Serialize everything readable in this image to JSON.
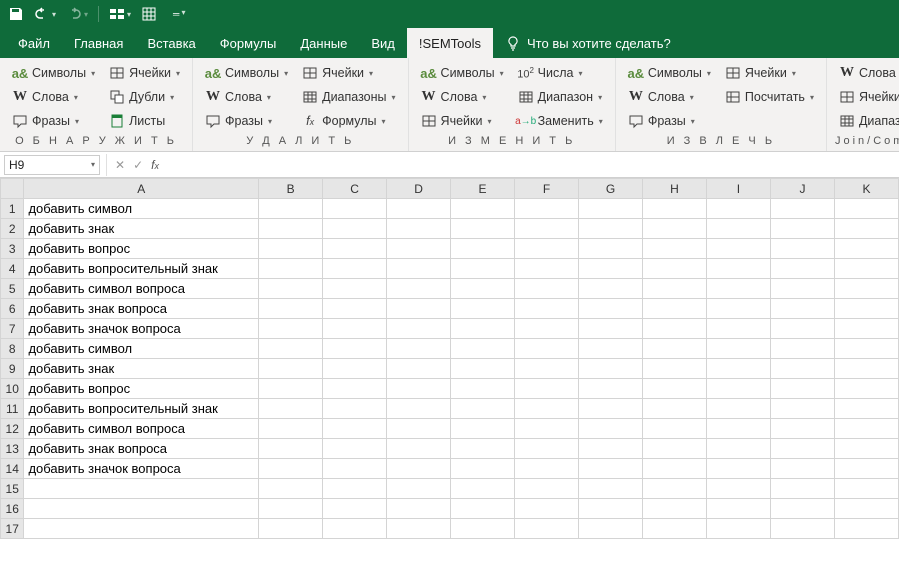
{
  "tabs": [
    "Файл",
    "Главная",
    "Вставка",
    "Формулы",
    "Данные",
    "Вид",
    "!SEMTools"
  ],
  "active_tab": 6,
  "search_hint": "Что вы хотите сделать?",
  "ribbon": {
    "groups": [
      {
        "label": "О Б Н А Р У Ж И Т Ь",
        "btns": [
          {
            "ic": "sym",
            "t": "Символы"
          },
          {
            "ic": "W",
            "t": "Слова"
          },
          {
            "ic": "phr",
            "t": "Фразы"
          },
          {
            "ic": "cell",
            "t": "Ячейки"
          },
          {
            "ic": "dup",
            "t": "Дубли"
          },
          {
            "ic": "sheet",
            "t": "Листы",
            "dd": false
          }
        ]
      },
      {
        "label": "У Д А Л И Т Ь",
        "btns": [
          {
            "ic": "sym",
            "t": "Символы"
          },
          {
            "ic": "W",
            "t": "Слова"
          },
          {
            "ic": "phr",
            "t": "Фразы"
          },
          {
            "ic": "cell",
            "t": "Ячейки"
          },
          {
            "ic": "rng",
            "t": "Диапазоны"
          },
          {
            "ic": "fx",
            "t": "Формулы"
          }
        ]
      },
      {
        "label": "И З М Е Н И Т Ь",
        "btns": [
          {
            "ic": "sym",
            "t": "Символы"
          },
          {
            "ic": "W",
            "t": "Слова"
          },
          {
            "ic": "cell",
            "t": "Ячейки"
          },
          {
            "ic": "num",
            "t": "Числа"
          },
          {
            "ic": "rng",
            "t": "Диапазон"
          },
          {
            "ic": "rep",
            "t": "Заменить"
          }
        ]
      },
      {
        "label": "И З В Л Е Ч Ь",
        "btns": [
          {
            "ic": "sym",
            "t": "Символы"
          },
          {
            "ic": "W",
            "t": "Слова"
          },
          {
            "ic": "phr",
            "t": "Фразы"
          },
          {
            "ic": "cell",
            "t": "Ячейки"
          },
          {
            "ic": "cnt",
            "t": "Посчитать"
          }
        ]
      },
      {
        "label": "Join/Combine",
        "btns": [
          {
            "ic": "W",
            "t": "Слова"
          },
          {
            "ic": "cell",
            "t": "Ячейки"
          },
          {
            "ic": "rng",
            "t": "Диапазоны"
          }
        ]
      }
    ]
  },
  "namebox": "H9",
  "columns": [
    "A",
    "B",
    "C",
    "D",
    "E",
    "F",
    "G",
    "H",
    "I",
    "J",
    "K"
  ],
  "rows": [
    {
      "n": 1,
      "A": "добавить символ"
    },
    {
      "n": 2,
      "A": "добавить знак"
    },
    {
      "n": 3,
      "A": "добавить вопрос"
    },
    {
      "n": 4,
      "A": "добавить вопросительный знак"
    },
    {
      "n": 5,
      "A": "добавить символ вопроса"
    },
    {
      "n": 6,
      "A": "добавить знак вопроса"
    },
    {
      "n": 7,
      "A": "добавить значок вопроса"
    },
    {
      "n": 8,
      "A": "добавить символ"
    },
    {
      "n": 9,
      "A": "добавить знак"
    },
    {
      "n": 10,
      "A": "добавить вопрос"
    },
    {
      "n": 11,
      "A": "добавить вопросительный знак"
    },
    {
      "n": 12,
      "A": "добавить символ вопроса"
    },
    {
      "n": 13,
      "A": "добавить знак вопроса"
    },
    {
      "n": 14,
      "A": "добавить значок вопроса"
    },
    {
      "n": 15,
      "A": ""
    },
    {
      "n": 16,
      "A": ""
    },
    {
      "n": 17,
      "A": ""
    }
  ]
}
